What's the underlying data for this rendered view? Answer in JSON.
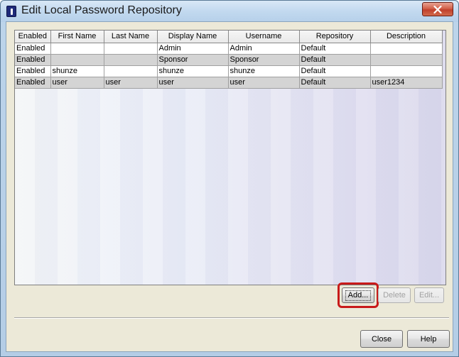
{
  "window": {
    "title": "Edit Local Password Repository"
  },
  "table": {
    "columns": [
      "Enabled",
      "First Name",
      "Last Name",
      "Display Name",
      "Username",
      "Repository",
      "Description"
    ],
    "rows": [
      {
        "enabled": "Enabled",
        "first_name": "",
        "last_name": "",
        "display_name": "Admin",
        "username": "Admin",
        "repository": "Default",
        "description": ""
      },
      {
        "enabled": "Enabled",
        "first_name": "",
        "last_name": "",
        "display_name": "Sponsor",
        "username": "Sponsor",
        "repository": "Default",
        "description": ""
      },
      {
        "enabled": "Enabled",
        "first_name": "shunze",
        "last_name": "",
        "display_name": "shunze",
        "username": "shunze",
        "repository": "Default",
        "description": ""
      },
      {
        "enabled": "Enabled",
        "first_name": "user",
        "last_name": "user",
        "display_name": "user",
        "username": "user",
        "repository": "Default",
        "description": "user1234"
      }
    ]
  },
  "actions": {
    "add_label": "Add...",
    "delete_label": "Delete",
    "edit_label": "Edit..."
  },
  "footer": {
    "close_label": "Close",
    "help_label": "Help"
  },
  "colors": {
    "highlight": "#c81a1a",
    "titlebar": "#c2d9ef",
    "dialog_background": "#ece9d8"
  },
  "icons": {
    "app": "app-logo-icon",
    "close": "close-x-icon"
  }
}
